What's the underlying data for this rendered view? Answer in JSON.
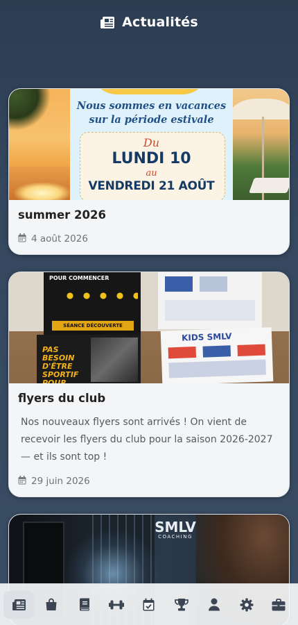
{
  "header": {
    "title": "Actualités",
    "icon": "newspaper-icon"
  },
  "colors": {
    "background": "#34475e",
    "card": "#f4f5f7",
    "nav_icon": "#3b4553",
    "nav_active_bg": "#dde0e4"
  },
  "posts": [
    {
      "title": "summer 2026",
      "text": "",
      "date": "4 août 2026",
      "image": {
        "line1": "Nous sommes en vacances",
        "line2": "sur la période estivale",
        "du": "Du",
        "start": "LUNDI 10",
        "au": "au",
        "end": "VENDREDI 21 AOÛT"
      }
    },
    {
      "title": "flyers du club",
      "text": "Nos nouveaux flyers sont arrivés ! On vient de recevoir les flyers du club pour la saison 2026-2027 — et ils sont top !",
      "date": "29 juin 2026",
      "image": {
        "dark_top": "POUR COMMENCER",
        "dark_bar": "SÉANCE DÉCOUVERTE OFFERTE",
        "dark_bottom": "PAS BESOIN D'ÊTRE SPORTIF POUR",
        "kids": "KIDS SMLV"
      }
    },
    {
      "title": "",
      "text": "",
      "date": "",
      "image": {
        "logo": "SMLV",
        "logo_sub": "COACHING"
      }
    }
  ],
  "bottom_nav": {
    "items": [
      {
        "name": "news",
        "icon": "newspaper-icon",
        "active": true
      },
      {
        "name": "shop",
        "icon": "shopping-bag-icon",
        "active": false
      },
      {
        "name": "book",
        "icon": "book-icon",
        "active": false
      },
      {
        "name": "workout",
        "icon": "dumbbell-icon",
        "active": false
      },
      {
        "name": "calendar",
        "icon": "calendar-check-icon",
        "active": false
      },
      {
        "name": "trophy",
        "icon": "trophy-icon",
        "active": false
      },
      {
        "name": "profile",
        "icon": "user-icon",
        "active": false
      },
      {
        "name": "settings",
        "icon": "gear-icon",
        "active": false
      },
      {
        "name": "briefcase",
        "icon": "briefcase-icon",
        "active": false
      }
    ]
  }
}
